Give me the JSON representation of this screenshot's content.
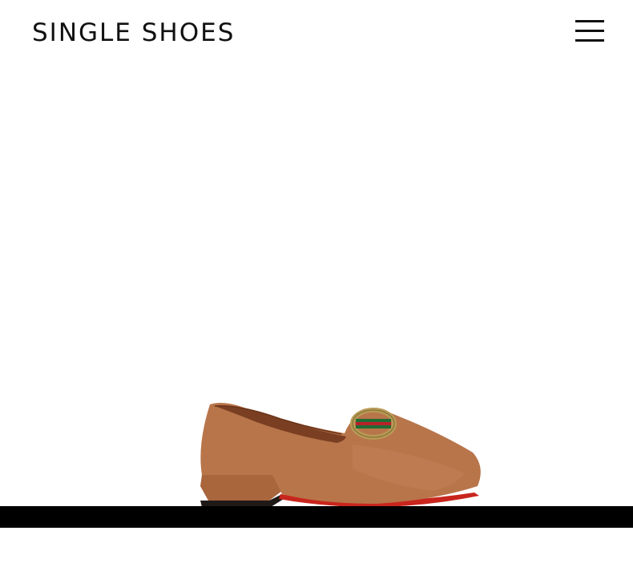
{
  "header": {
    "brand": "SINGLE SHOES",
    "menu_icon": "hamburger-menu-icon"
  },
  "hero": {
    "product_image_alt": "",
    "product_icon": "loafer-shoe-icon"
  },
  "colors": {
    "background": "#ffffff",
    "text": "#111111",
    "bar": "#000000",
    "suede": "#b8754a",
    "sole": "#c8251d"
  }
}
